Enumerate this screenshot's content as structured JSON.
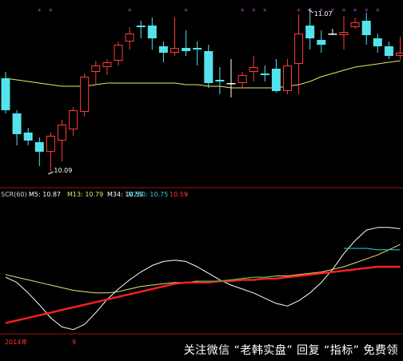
{
  "colors": {
    "background": "#000000",
    "up": "#ff3b3b",
    "down": "#54e3ec",
    "flat": "#ffffff",
    "ma_main": "#e8e86a",
    "marker_purple": "#c23bd6",
    "price_label": "#ffffff",
    "separator": "#a01010",
    "scr_white": "#ffffff",
    "scr_yellow": "#e5e57a",
    "scr_red": "#ff2020",
    "scr_cyan": "#33cfe0",
    "scr_green": "#2ed24a"
  },
  "upper_chart": {
    "chart_data": {
      "type": "candlestick",
      "ylim": [
        10.05,
        11.17
      ],
      "high_label": "11.07",
      "low_label": "10.09",
      "candles": [
        {
          "o": 10.72,
          "h": 10.76,
          "c": 10.52,
          "l": 10.5
        },
        {
          "o": 10.5,
          "h": 10.52,
          "c": 10.37,
          "l": 10.3
        },
        {
          "o": 10.38,
          "h": 10.41,
          "c": 10.33,
          "l": 10.3
        },
        {
          "o": 10.32,
          "h": 10.35,
          "c": 10.26,
          "l": 10.17
        },
        {
          "o": 10.26,
          "h": 10.38,
          "c": 10.36,
          "l": 10.14
        },
        {
          "o": 10.33,
          "h": 10.46,
          "c": 10.43,
          "l": 10.2
        },
        {
          "o": 10.4,
          "h": 10.54,
          "c": 10.52,
          "l": 10.36
        },
        {
          "o": 10.51,
          "h": 10.75,
          "c": 10.73,
          "l": 10.48
        },
        {
          "o": 10.76,
          "h": 10.83,
          "c": 10.8,
          "l": 10.68
        },
        {
          "o": 10.79,
          "h": 10.84,
          "c": 10.82,
          "l": 10.74
        },
        {
          "o": 10.83,
          "h": 10.95,
          "c": 10.93,
          "l": 10.8
        },
        {
          "o": 10.95,
          "h": 11.04,
          "c": 11.0,
          "l": 10.9
        },
        {
          "o": 11.05,
          "h": 11.08,
          "c": 11.04,
          "l": 10.97
        },
        {
          "o": 11.05,
          "h": 11.1,
          "c": 10.97,
          "l": 10.9
        },
        {
          "o": 10.92,
          "h": 10.95,
          "c": 10.88,
          "l": 10.82
        },
        {
          "o": 10.88,
          "h": 11.1,
          "c": 10.91,
          "l": 10.86
        },
        {
          "o": 10.91,
          "h": 11.02,
          "c": 10.89,
          "l": 10.86
        },
        {
          "o": 10.91,
          "h": 10.95,
          "c": 10.9,
          "l": 10.8
        },
        {
          "o": 10.89,
          "h": 10.93,
          "c": 10.69,
          "l": 10.66
        },
        {
          "o": 10.71,
          "h": 10.79,
          "c": 10.7,
          "l": 10.62
        },
        {
          "o": 10.69,
          "h": 10.84,
          "c": 10.69,
          "l": 10.6
        },
        {
          "o": 10.69,
          "h": 10.76,
          "c": 10.74,
          "l": 10.66
        },
        {
          "o": 10.76,
          "h": 10.86,
          "c": 10.79,
          "l": 10.7
        },
        {
          "o": 10.75,
          "h": 10.8,
          "c": 10.74,
          "l": 10.7
        },
        {
          "o": 10.78,
          "h": 10.84,
          "c": 10.64,
          "l": 10.63
        },
        {
          "o": 10.64,
          "h": 10.84,
          "c": 10.8,
          "l": 10.62
        },
        {
          "o": 10.81,
          "h": 11.12,
          "c": 11.0,
          "l": 10.62
        },
        {
          "o": 11.05,
          "h": 11.16,
          "c": 10.97,
          "l": 10.9
        },
        {
          "o": 10.96,
          "h": 11.02,
          "c": 10.93,
          "l": 10.88
        },
        {
          "o": 11.0,
          "h": 11.03,
          "c": 11.0,
          "l": 10.99
        },
        {
          "o": 10.99,
          "h": 11.11,
          "c": 11.01,
          "l": 10.9
        },
        {
          "o": 11.04,
          "h": 11.1,
          "c": 11.07,
          "l": 11.03
        },
        {
          "o": 11.08,
          "h": 11.13,
          "c": 10.99,
          "l": 10.93
        },
        {
          "o": 10.97,
          "h": 11.0,
          "c": 10.92,
          "l": 10.88
        },
        {
          "o": 10.92,
          "h": 10.95,
          "c": 10.86,
          "l": 10.84
        },
        {
          "o": 10.86,
          "h": 10.98,
          "c": 10.88,
          "l": 10.84
        }
      ],
      "ma_line": [
        10.72,
        10.71,
        10.7,
        10.69,
        10.68,
        10.67,
        10.67,
        10.67,
        10.68,
        10.69,
        10.69,
        10.69,
        10.69,
        10.69,
        10.69,
        10.69,
        10.68,
        10.68,
        10.67,
        10.67,
        10.66,
        10.66,
        10.66,
        10.66,
        10.66,
        10.67,
        10.68,
        10.7,
        10.73,
        10.75,
        10.77,
        10.79,
        10.8,
        10.81,
        10.82,
        10.83
      ],
      "markers_at": [
        3,
        4,
        11,
        16,
        21,
        22,
        23,
        26,
        27,
        28,
        29,
        30,
        31,
        32,
        33
      ]
    }
  },
  "lower_chart": {
    "legend": {
      "title": "SCR(60)",
      "m5": "M5: 10.87",
      "m13": "M13: 10.79",
      "m34": "M34: 10.59",
      "m250": "M250: 10.75",
      "extra": "10.59",
      "trail": "-"
    },
    "chart_data": {
      "type": "line",
      "x": [
        0,
        1,
        2,
        3,
        4,
        5,
        6,
        7,
        8,
        9,
        10,
        11,
        12,
        13,
        14,
        15,
        16,
        17,
        18,
        19,
        20,
        21,
        22,
        23,
        24,
        25,
        26,
        27,
        28,
        29,
        30,
        31,
        32,
        33,
        34,
        35
      ],
      "ylim": [
        0,
        100
      ],
      "series": [
        {
          "name": "M5",
          "color": "white",
          "values": [
            42,
            38,
            30,
            21,
            11,
            4,
            2,
            6,
            15,
            25,
            33,
            40,
            46,
            51,
            54,
            55,
            54,
            50,
            45,
            40,
            36,
            33,
            30,
            26,
            22,
            20,
            24,
            30,
            38,
            48,
            60,
            70,
            78,
            80,
            80,
            79
          ]
        },
        {
          "name": "M13",
          "color": "yellow",
          "values": [
            44,
            42,
            40,
            38,
            36,
            34,
            32,
            31,
            30,
            30,
            31,
            33,
            35,
            36,
            37,
            38,
            38,
            39,
            39,
            39,
            40,
            41,
            42,
            42,
            43,
            43,
            44,
            45,
            46,
            48,
            50,
            53,
            56,
            59,
            63,
            67
          ]
        },
        {
          "name": "M34",
          "color": "red",
          "values": [
            7,
            9,
            11,
            13,
            15,
            17,
            19,
            21,
            23,
            25,
            27,
            29,
            31,
            33,
            35,
            37,
            38,
            38,
            38,
            39,
            39,
            40,
            40,
            41,
            41,
            42,
            43,
            44,
            45,
            46,
            47,
            48,
            49,
            50,
            50,
            50
          ]
        },
        {
          "name": "M250",
          "color": "cyan",
          "values": [
            null,
            null,
            null,
            null,
            null,
            null,
            null,
            null,
            null,
            null,
            null,
            null,
            null,
            null,
            null,
            null,
            null,
            null,
            null,
            null,
            null,
            null,
            null,
            null,
            null,
            null,
            null,
            null,
            null,
            null,
            64,
            64,
            64,
            63,
            63,
            63
          ]
        }
      ]
    }
  },
  "bottom_strip": {
    "year_label": "2014年",
    "month_label": "9",
    "watermark": "关注微信 “老韩实盘” 回复 “指标” 免费领"
  }
}
